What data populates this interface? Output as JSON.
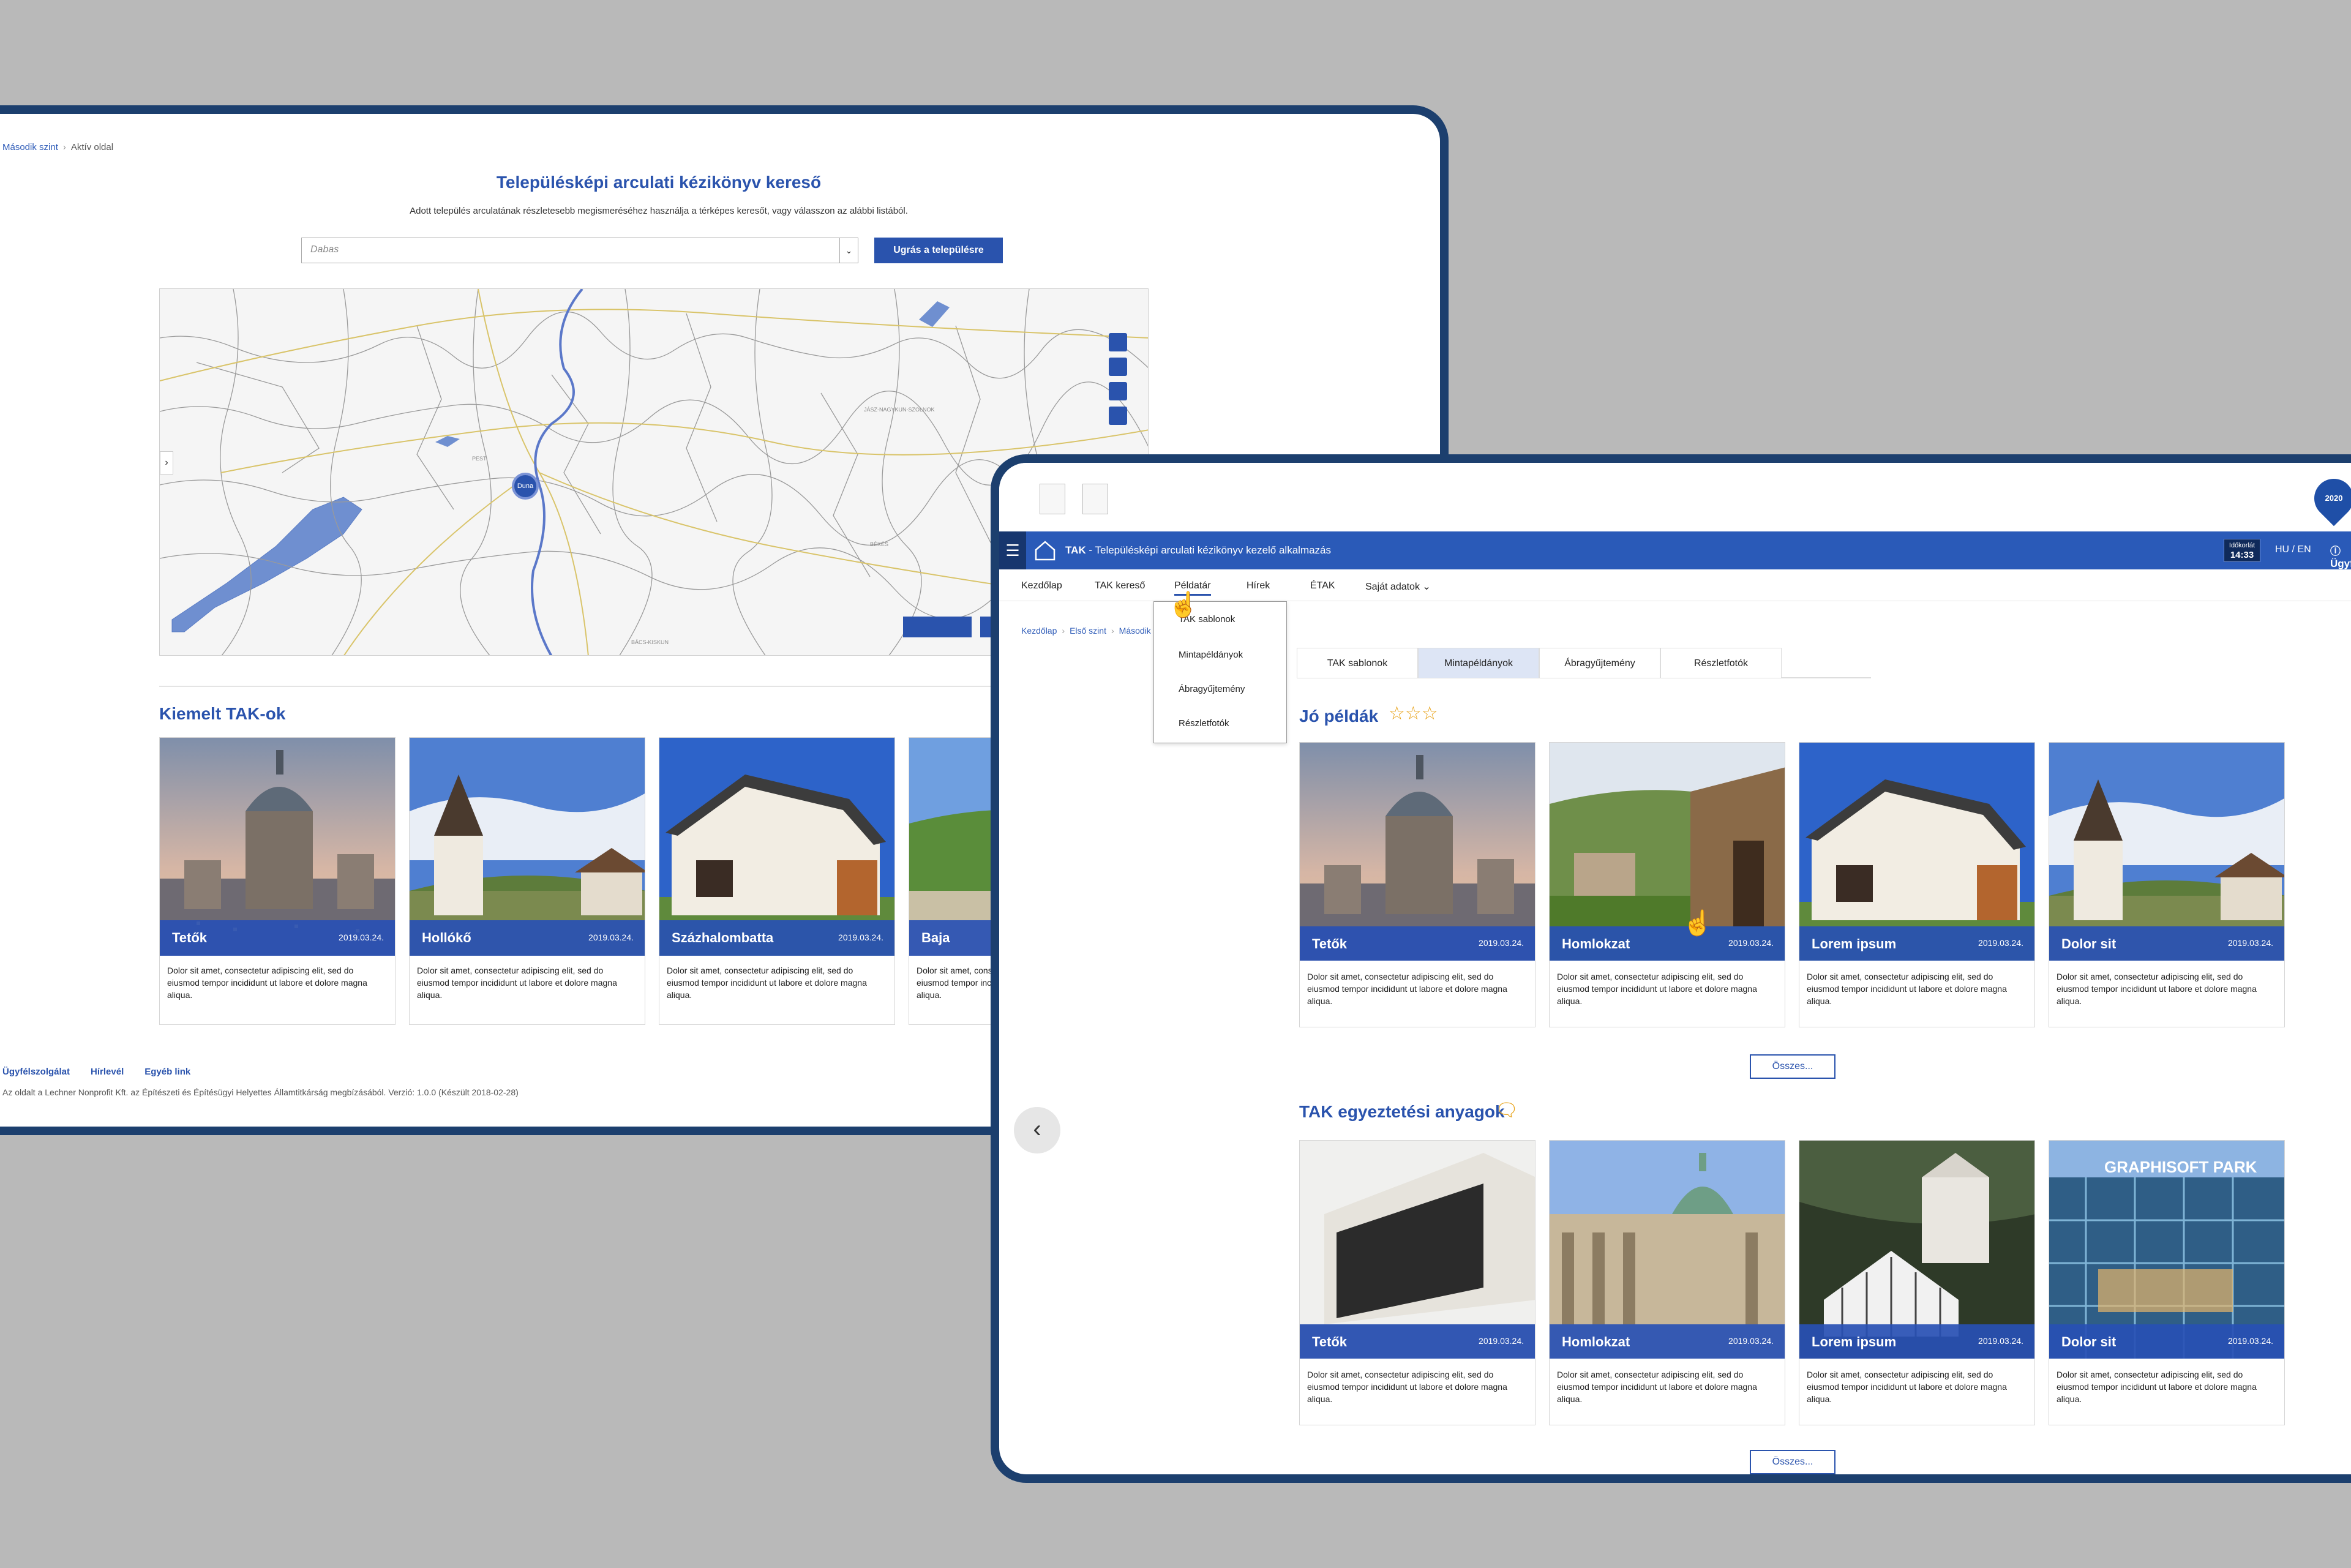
{
  "colors": {
    "brand_blue": "#2a53ad",
    "frame": "#1c3f6e",
    "accent": "#e8a31a"
  },
  "screen1": {
    "breadcrumb": {
      "level": "Második szint",
      "active": "Aktív oldal"
    },
    "title": "Településképi arculati kézikönyv kereső",
    "subtitle": "Adott település arculatának részletesebb megismeréséhez használja a térképes keresőt, vagy válasszon az alábbi listából.",
    "select_value": "Dabas",
    "jump_button": "Ugrás a településre",
    "map_marker_label": "Duna",
    "featured_title": "Kiemelt TAK-ok",
    "cards": [
      {
        "title": "Tetők",
        "date": "2019.03.24.",
        "text": "Dolor sit amet, consectetur adipiscing elit, sed do eiusmod tempor incididunt ut labore et dolore magna aliqua."
      },
      {
        "title": "Hollókő",
        "date": "2019.03.24.",
        "text": "Dolor sit amet, consectetur adipiscing elit, sed do eiusmod tempor incididunt ut labore et dolore magna aliqua."
      },
      {
        "title": "Százhalombatta",
        "date": "2019.03.24.",
        "text": "Dolor sit amet, consectetur adipiscing elit, sed do eiusmod tempor incididunt ut labore et dolore magna aliqua."
      },
      {
        "title": "Baja",
        "date": "",
        "text": "Dolor sit amet, consectetur adipiscing elit, sed do eiusmod tempor incididunt ut labore et dolore magna aliqua."
      }
    ],
    "footer_links": [
      "Ügyfélszolgálat",
      "Hírlevél",
      "Egyéb link"
    ],
    "footer_text": "Az oldalt a Lechner Nonprofit Kft. az Építészeti és Építésügyi Helyettes Államtitkárság megbízásából. Verzió: 1.0.0 (Készült 2018-02-28)"
  },
  "screen2": {
    "app_title_bold": "TAK",
    "app_title": " - Településképi arculati kézikönyv kezelő alkalmazás",
    "clock_label": "Időkorlát",
    "clock_value": "14:33",
    "lang": "HU / EN",
    "help": "Ügyfélszolgálat",
    "pin_label": "2020",
    "nav": [
      "Kezdőlap",
      "TAK kereső",
      "Példatár",
      "Hírek",
      "ÉTAK",
      "Saját adatok ⌄"
    ],
    "dropdown": [
      "TAK sablonok",
      "Mintapéldányok",
      "Ábragyűjtemény",
      "Részletfotók"
    ],
    "breadcrumb": [
      "Kezdőlap",
      "Első szint",
      "Második szint"
    ],
    "tabs": [
      "TAK sablonok",
      "Mintapéldányok",
      "Ábragyűjtemény",
      "Részletfotók"
    ],
    "section1_title": "Jó példák",
    "section1_cards": [
      {
        "title": "Tetők",
        "date": "2019.03.24.",
        "text": "Dolor sit amet, consectetur adipiscing elit, sed do eiusmod tempor incididunt ut labore et dolore magna aliqua."
      },
      {
        "title": "Homlokzat",
        "date": "2019.03.24.",
        "text": "Dolor sit amet, consectetur adipiscing elit, sed do eiusmod tempor incididunt ut labore et dolore magna aliqua."
      },
      {
        "title": "Lorem ipsum",
        "date": "2019.03.24.",
        "text": "Dolor sit amet, consectetur adipiscing elit, sed do eiusmod tempor incididunt ut labore et dolore magna aliqua."
      },
      {
        "title": "Dolor sit",
        "date": "2019.03.24.",
        "text": "Dolor sit amet, consectetur adipiscing elit, sed do eiusmod tempor incididunt ut labore et dolore magna aliqua."
      }
    ],
    "all_button": "Összes...",
    "section2_title": "TAK egyeztetési anyagok",
    "section2_cards": [
      {
        "title": "Tetők",
        "date": "2019.03.24.",
        "text": "Dolor sit amet, consectetur adipiscing elit, sed do eiusmod tempor incididunt ut labore et dolore magna aliqua."
      },
      {
        "title": "Homlokzat",
        "date": "2019.03.24.",
        "text": "Dolor sit amet, consectetur adipiscing elit, sed do eiusmod tempor incididunt ut labore et dolore magna aliqua."
      },
      {
        "title": "Lorem ipsum",
        "date": "2019.03.24.",
        "text": "Dolor sit amet, consectetur adipiscing elit, sed do eiusmod tempor incididunt ut labore et dolore magna aliqua."
      },
      {
        "title": "Dolor sit",
        "date": "2019.03.24.",
        "text": "Dolor sit amet, consectetur adipiscing elit, sed do eiusmod tempor incididunt ut labore et dolore magna aliqua."
      }
    ],
    "all_button2": "Összes...",
    "sign_text": "GRAPHISOFT PARK"
  }
}
